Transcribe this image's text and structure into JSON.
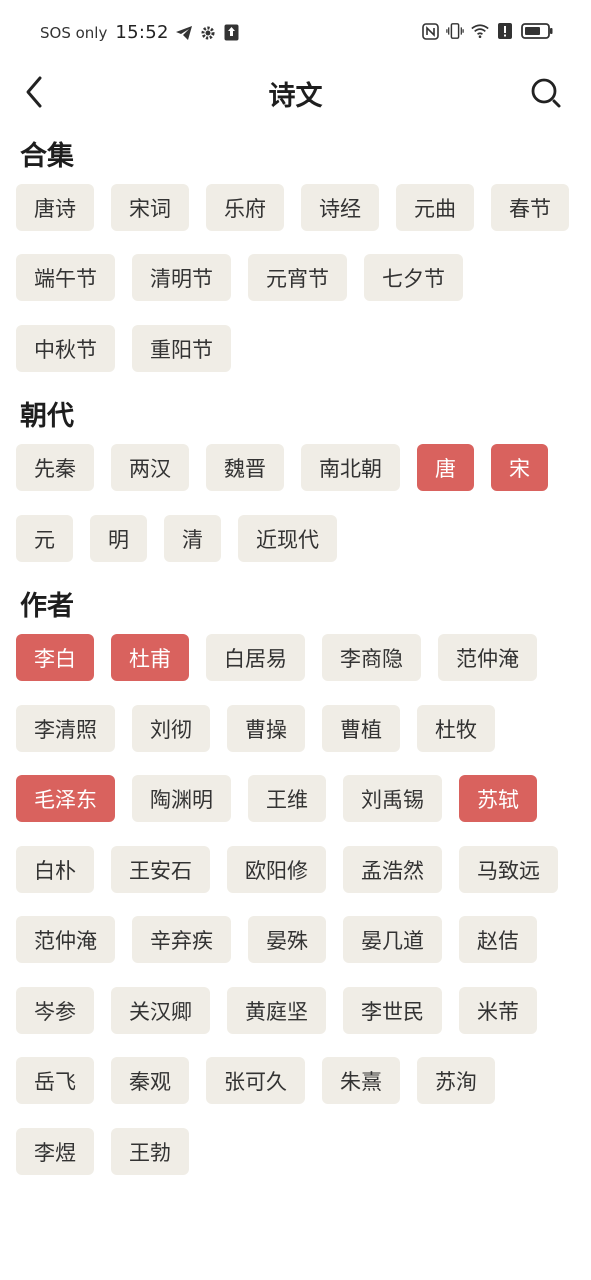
{
  "status_bar": {
    "sos": "SOS only",
    "time": "15:52",
    "left_icons": [
      "telegram-icon",
      "gear-icon",
      "upload-icon"
    ],
    "right_icons": [
      "nfc-icon",
      "vibrate-icon",
      "wifi-icon",
      "alert-icon",
      "battery-icon"
    ]
  },
  "nav": {
    "title": "诗文"
  },
  "sections": {
    "collections": {
      "title": "合集",
      "rows": [
        [
          "唐诗",
          "宋词",
          "乐府",
          "诗经",
          "元曲",
          "春节"
        ],
        [
          "端午节",
          "清明节",
          "元宵节",
          "七夕节"
        ],
        [
          "中秋节",
          "重阳节"
        ]
      ]
    },
    "dynasty": {
      "title": "朝代",
      "rows": [
        [
          "先秦",
          "两汉",
          "魏晋",
          "南北朝",
          "唐",
          "宋"
        ],
        [
          "元",
          "明",
          "清",
          "近现代"
        ]
      ],
      "selected": [
        "唐",
        "宋"
      ]
    },
    "author": {
      "title": "作者",
      "rows": [
        [
          "李白",
          "杜甫",
          "白居易",
          "李商隐",
          "范仲淹"
        ],
        [
          "李清照",
          "刘彻",
          "曹操",
          "曹植",
          "杜牧"
        ],
        [
          "毛泽东",
          "陶渊明",
          "王维",
          "刘禹锡",
          "苏轼"
        ],
        [
          "白朴",
          "王安石",
          "欧阳修",
          "孟浩然",
          "马致远"
        ],
        [
          "范仲淹",
          "辛弃疾",
          "晏殊",
          "晏几道",
          "赵佶"
        ],
        [
          "岑参",
          "关汉卿",
          "黄庭坚",
          "李世民",
          "米芾"
        ],
        [
          "岳飞",
          "秦观",
          "张可久",
          "朱熹",
          "苏洵"
        ],
        [
          "李煜",
          "王勃"
        ]
      ],
      "selected": [
        "李白",
        "杜甫",
        "毛泽东",
        "苏轼"
      ]
    }
  },
  "colors": {
    "selected": "#d9625e",
    "tag_bg": "#f0ede6"
  }
}
